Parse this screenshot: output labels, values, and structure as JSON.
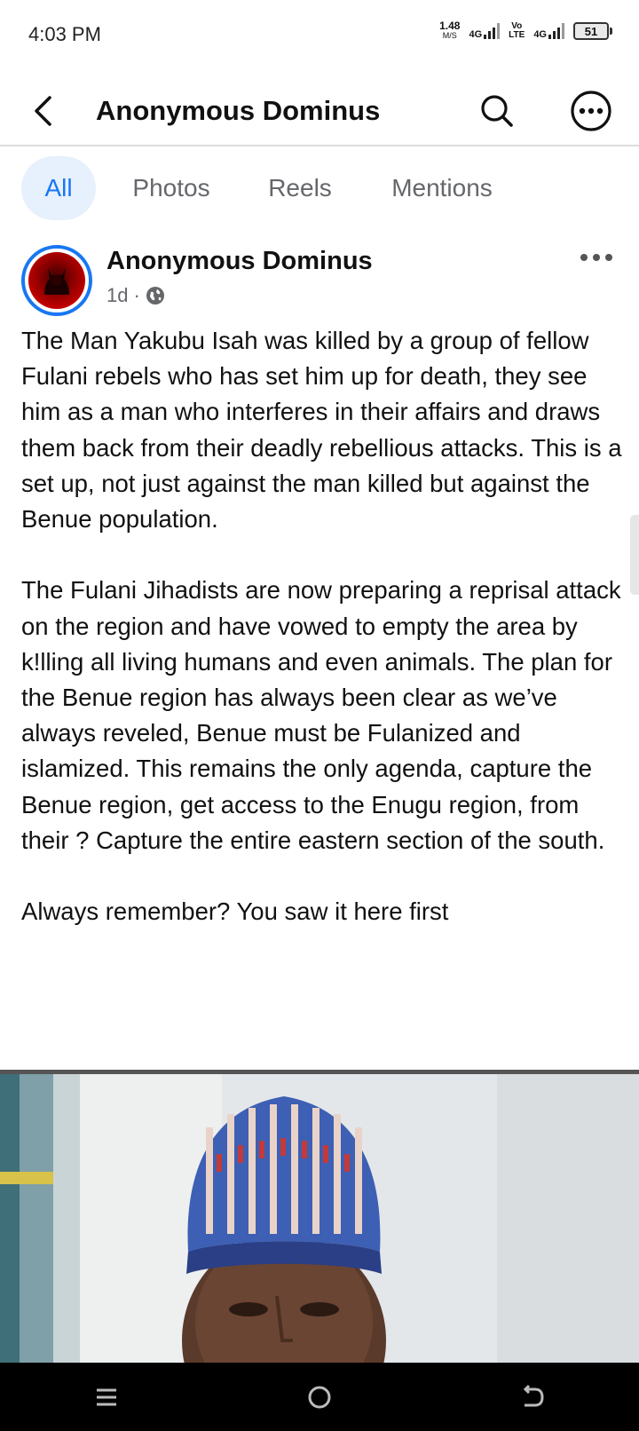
{
  "status_bar": {
    "time": "4:03 PM",
    "net_speed_value": "1.48",
    "net_speed_unit": "M/S",
    "sim1_label": "4G",
    "volte_top": "Vo",
    "volte_bottom": "LTE",
    "sim2_label": "4G",
    "battery_level": "51"
  },
  "header": {
    "title": "Anonymous Dominus",
    "back_icon": "chevron-left-icon",
    "search_icon": "search-icon",
    "more_icon": "more-circle-icon"
  },
  "tabs": [
    {
      "label": "All",
      "active": true
    },
    {
      "label": "Photos",
      "active": false
    },
    {
      "label": "Reels",
      "active": false
    },
    {
      "label": "Mentions",
      "active": false
    }
  ],
  "post": {
    "author": "Anonymous Dominus",
    "time": "1d",
    "separator": "·",
    "privacy_icon": "globe-icon",
    "paragraphs": [
      "The Man Yakubu Isah was killed by a group of fellow Fulani rebels who has set him up for death, they see him as a man who interferes in their affairs and draws them back from their deadly rebellious attacks. This is a set up, not just against the man killed but against the Benue population.",
      "The Fulani Jihadists are now preparing a reprisal attack on the region and have vowed to empty the area by k!lling all living humans and even animals. The plan for the Benue region has always been clear as we’ve always reveled, Benue must be Fulanized and islamized. This remains the only agenda, capture the Benue region, get access to the Enugu region, from their ? Capture the entire eastern section of the south.",
      "Always remember? You saw it here first"
    ]
  },
  "nav": {
    "recents_icon": "recents-icon",
    "home_icon": "home-icon",
    "back_icon": "back-icon"
  },
  "colors": {
    "accent": "#1877f2",
    "tab_active_bg": "#e7f0fd",
    "muted_text": "#65676b"
  }
}
